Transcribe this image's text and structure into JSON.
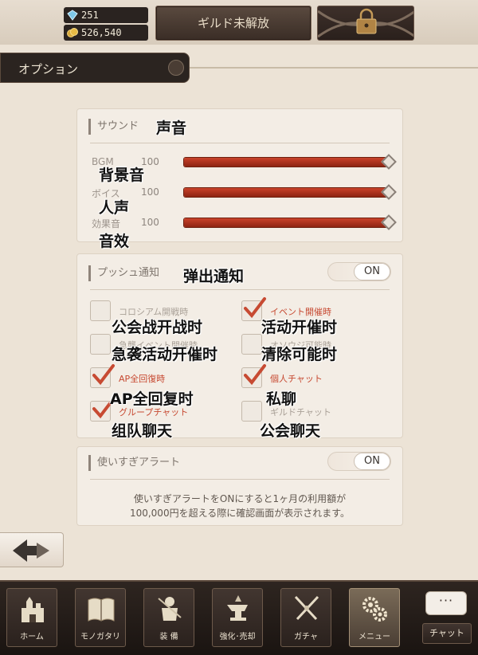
{
  "currency": {
    "gems": "251",
    "gold": "526,540"
  },
  "guild": {
    "label": "ギルド未解放"
  },
  "header": {
    "title": "オプション"
  },
  "sound": {
    "title": "サウンド",
    "title_note": "声音",
    "sliders": [
      {
        "label": "BGM",
        "value": "100",
        "note": "背景音",
        "level": 1.0
      },
      {
        "label": "ボイス",
        "value": "100",
        "note": "人声",
        "level": 1.0
      },
      {
        "label": "効果音",
        "value": "100",
        "note": "音效",
        "level": 1.0
      }
    ]
  },
  "push": {
    "title": "プッシュ通知",
    "title_note": "弹出通知",
    "toggle": "ON",
    "options": [
      {
        "label": "コロシアム開戦時",
        "note": "公会战开战时",
        "checked": false
      },
      {
        "label": "イベント開催時",
        "note": "活动开催时",
        "checked": true
      },
      {
        "label": "急襲イベント開催時",
        "note": "急袭活动开催时",
        "checked": false
      },
      {
        "label": "オソウジ可能時",
        "note": "清除可能时",
        "checked": false
      },
      {
        "label": "AP全回復時",
        "note": "AP全回复时",
        "checked": true
      },
      {
        "label": "個人チャット",
        "note": "私聊",
        "checked": true
      },
      {
        "label": "グループチャット",
        "note": "组队聊天",
        "checked": true
      },
      {
        "label": "ギルドチャット",
        "note": "公会聊天",
        "checked": false
      }
    ]
  },
  "alert": {
    "title": "使いすぎアラート",
    "toggle": "ON",
    "note_line1": "使いすぎアラートをONにすると1ヶ月の利用額が",
    "note_line2": "100,000円を超える際に確認画面が表示されます。"
  },
  "nav": {
    "items": [
      {
        "label": "ホーム",
        "icon": "castle-icon"
      },
      {
        "label": "モノガタリ",
        "icon": "book-icon"
      },
      {
        "label": "装 備",
        "icon": "armor-icon"
      },
      {
        "label": "強化･売却",
        "icon": "anvil-icon"
      },
      {
        "label": "ガチャ",
        "icon": "crossed-swords-icon"
      },
      {
        "label": "メニュー",
        "icon": "gears-icon"
      }
    ],
    "chat_label": "チャット",
    "chat_bubble": "···"
  },
  "colors": {
    "accent": "#c9422a",
    "check": "#c74a32",
    "dark": "#2b2420"
  }
}
